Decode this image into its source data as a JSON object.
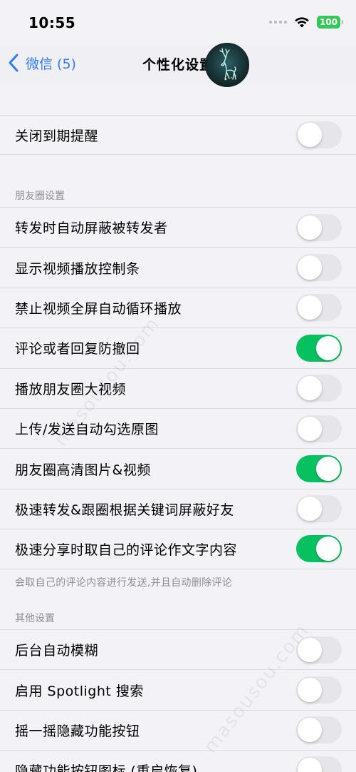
{
  "status_bar": {
    "time": "10:55",
    "battery": "100"
  },
  "nav": {
    "back_label": "微信 (5)",
    "title": "个性化设置"
  },
  "top_group": [
    {
      "label": "关闭到期提醒",
      "on": false
    }
  ],
  "moments_section": {
    "header": "朋友圈设置",
    "items": [
      {
        "label": "转发时自动屏蔽被转发者",
        "on": false
      },
      {
        "label": "显示视频播放控制条",
        "on": false
      },
      {
        "label": "禁止视频全屏自动循环播放",
        "on": false
      },
      {
        "label": "评论或者回复防撤回",
        "on": true
      },
      {
        "label": "播放朋友圈大视频",
        "on": false
      },
      {
        "label": "上传/发送自动勾选原图",
        "on": false
      },
      {
        "label": "朋友圈高清图片&视频",
        "on": true
      },
      {
        "label": "极速转发&跟圈根据关键词屏蔽好友",
        "on": false
      },
      {
        "label": "极速分享时取自己的评论作文字内容",
        "on": true
      }
    ],
    "footer": "会取自己的评论内容进行发送,并且自动删除评论"
  },
  "other_section": {
    "header": "其他设置",
    "items": [
      {
        "label": "后台自动模糊",
        "on": false
      },
      {
        "label": "启用 Spotlight 搜索",
        "on": false
      },
      {
        "label": "摇一摇隐藏功能按钮",
        "on": false
      },
      {
        "label": "隐藏功能按钮图标 (重启恢复)",
        "on": false
      }
    ]
  },
  "watermark": "masousou.com",
  "colors": {
    "accent": "#2f7cf6",
    "toggle_on": "#07c160",
    "toggle_off": "#e5e5ea",
    "background": "#f2f2f7"
  }
}
